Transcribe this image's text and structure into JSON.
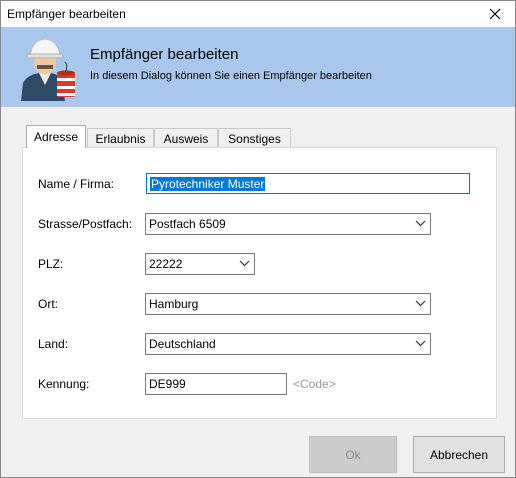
{
  "window": {
    "title": "Empfänger bearbeiten"
  },
  "header": {
    "title": "Empfänger bearbeiten",
    "subtitle": "In diesem Dialog können Sie einen Empfänger bearbeiten"
  },
  "tabs": [
    {
      "label": "Adresse",
      "active": true
    },
    {
      "label": "Erlaubnis"
    },
    {
      "label": "Ausweis"
    },
    {
      "label": "Sonstiges"
    }
  ],
  "form": {
    "name": {
      "label": "Name / Firma:",
      "value": "Pyrotechniker Muster"
    },
    "street": {
      "label": "Strasse/Postfach:",
      "value": "Postfach 6509"
    },
    "zip": {
      "label": "PLZ:",
      "value": "22222"
    },
    "city": {
      "label": "Ort:",
      "value": "Hamburg"
    },
    "country": {
      "label": "Land:",
      "value": "Deutschland"
    },
    "code": {
      "label": "Kennung:",
      "value": "DE999",
      "hint": "<Code>"
    }
  },
  "buttons": {
    "ok": "Ok",
    "cancel": "Abbrechen"
  },
  "colors": {
    "banner": "#a9c7ec",
    "accent": "#0078d7"
  },
  "icons": {
    "avatar": "pyrotechnician-icon",
    "close": "close-icon",
    "dropdown": "chevron-down-icon"
  }
}
